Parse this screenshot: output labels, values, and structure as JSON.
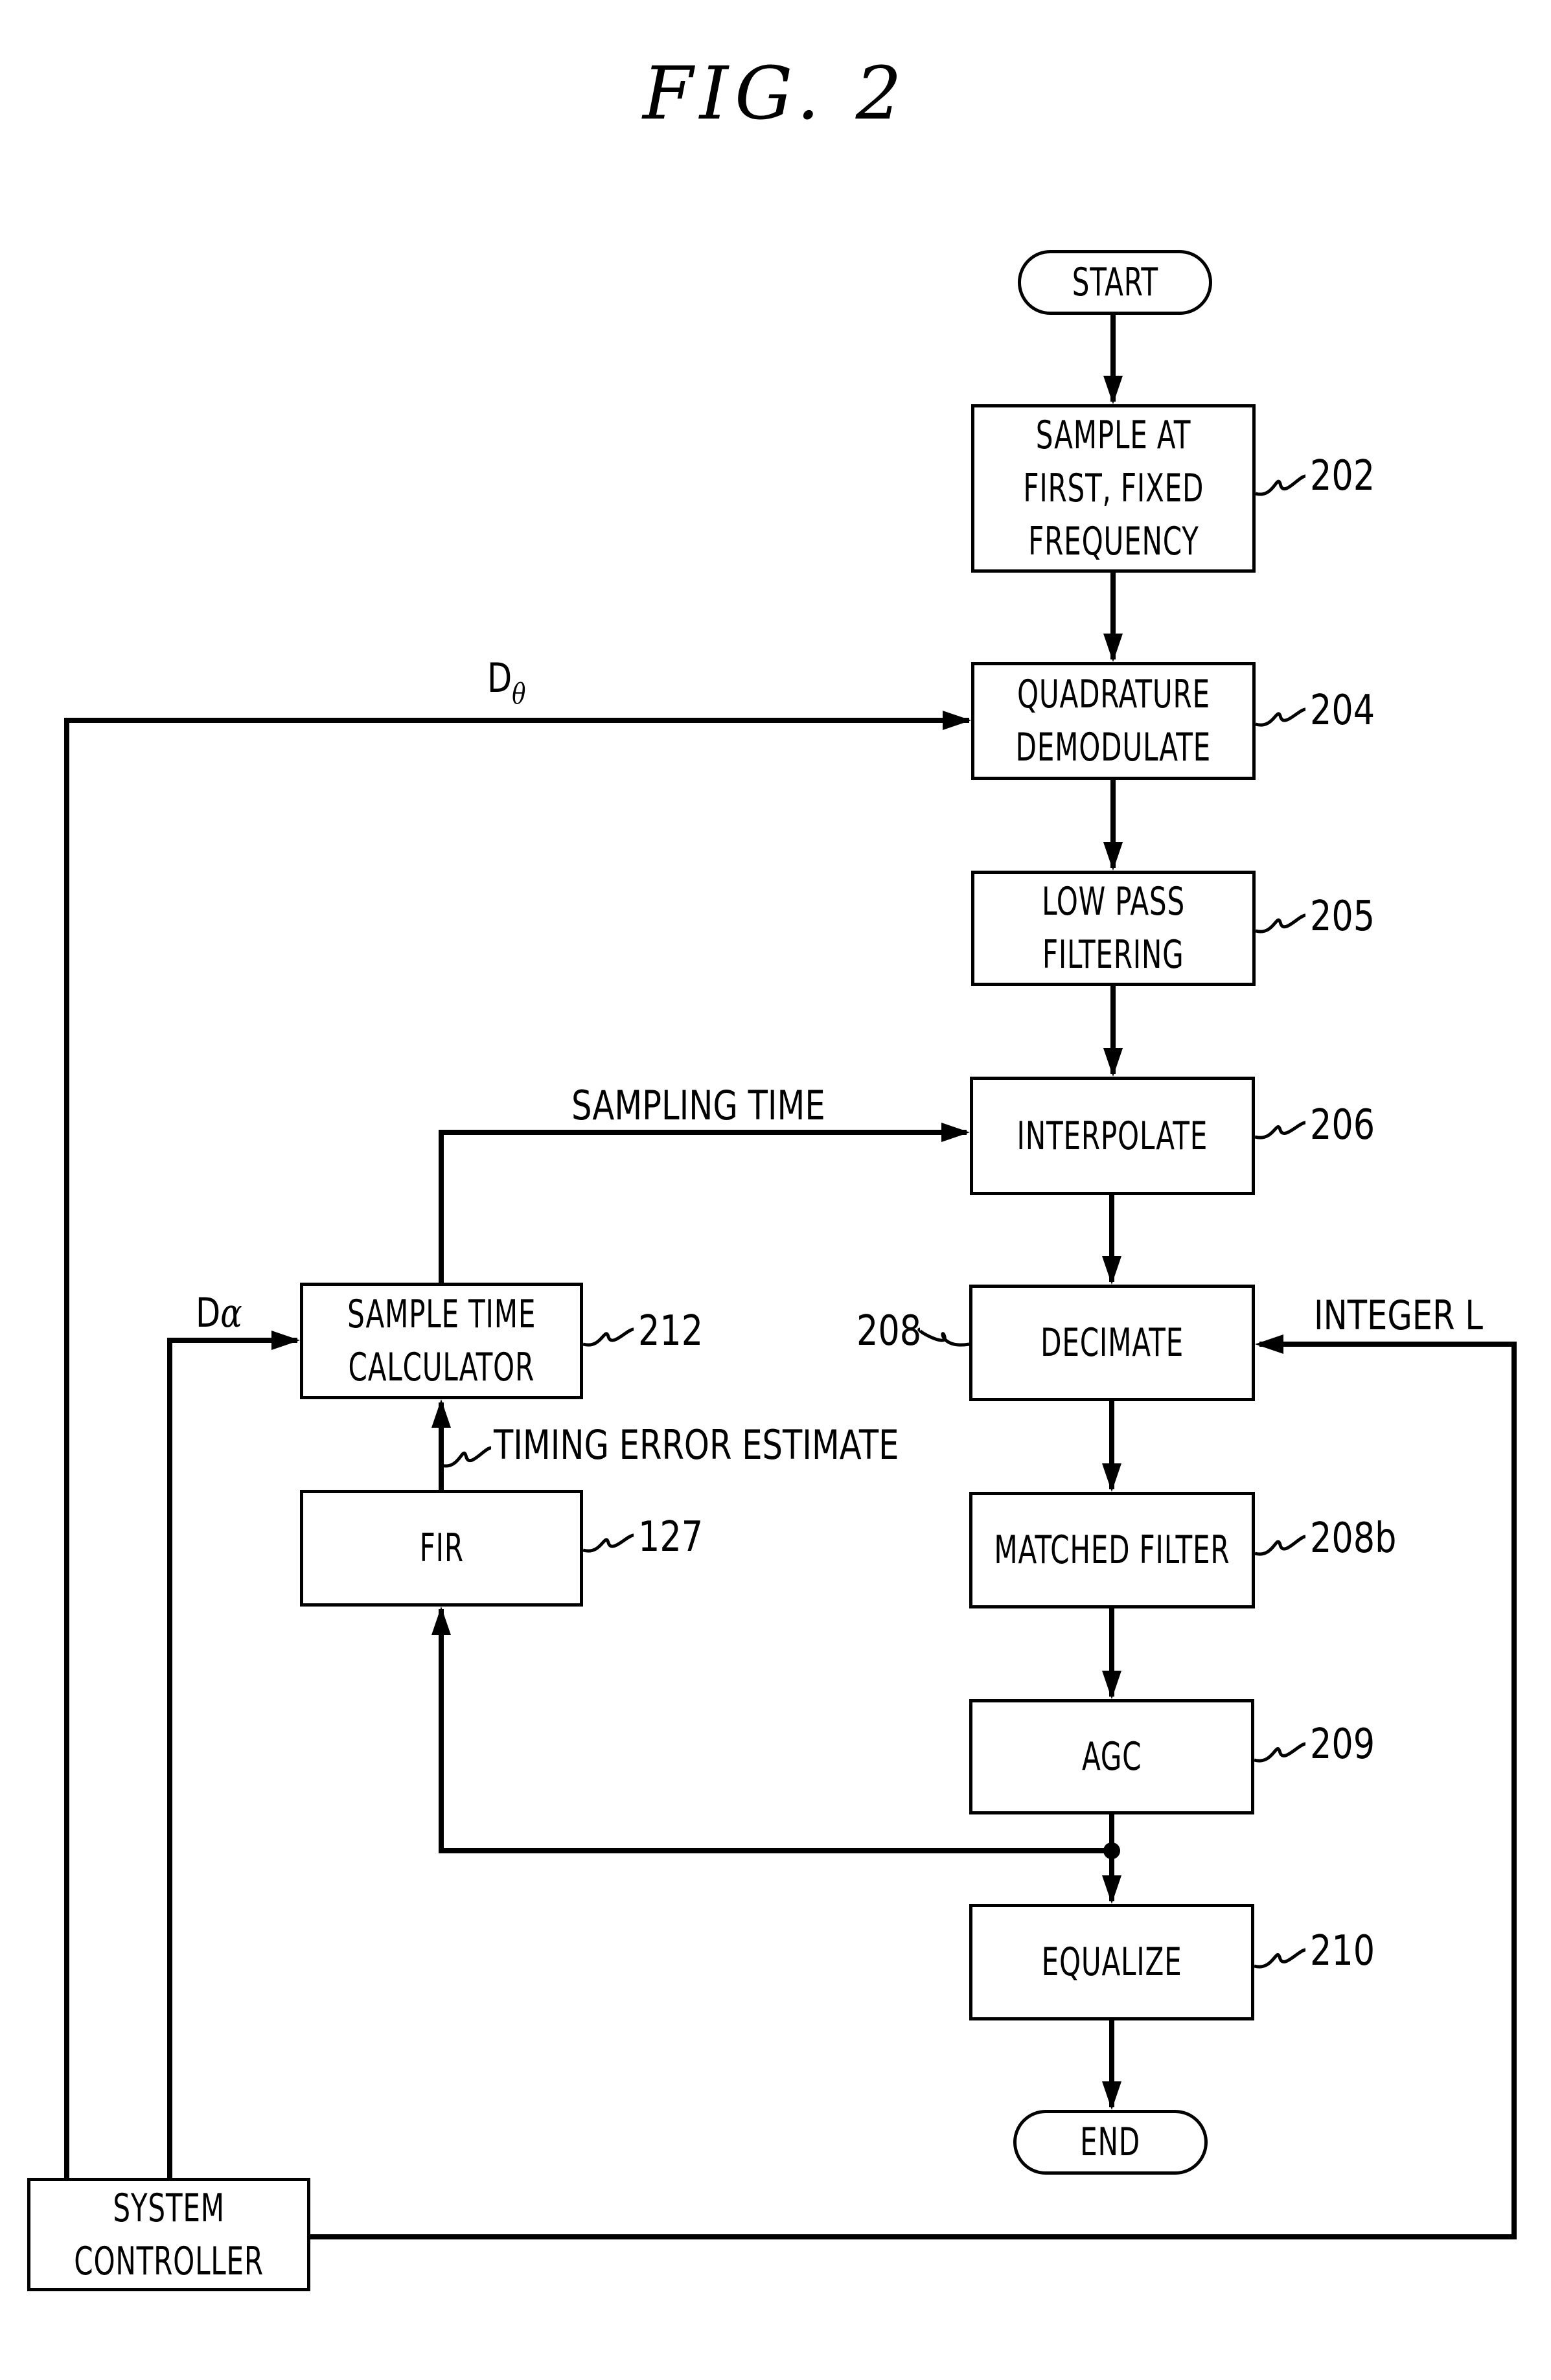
{
  "figure": {
    "title": "FIG. 2"
  },
  "nodes": {
    "start": {
      "lines": [
        "START"
      ]
    },
    "n202": {
      "lines": [
        "SAMPLE AT",
        "FIRST, FIXED",
        "FREQUENCY"
      ],
      "ref": "202"
    },
    "n204": {
      "lines": [
        "QUADRATURE",
        "DEMODULATE"
      ],
      "ref": "204"
    },
    "n205": {
      "lines": [
        "LOW PASS",
        "FILTERING"
      ],
      "ref": "205"
    },
    "n206": {
      "lines": [
        "INTERPOLATE"
      ],
      "ref": "206"
    },
    "n208": {
      "lines": [
        "DECIMATE"
      ],
      "ref": "208"
    },
    "n208b": {
      "lines": [
        "MATCHED FILTER"
      ],
      "ref": "208b"
    },
    "n209": {
      "lines": [
        "AGC"
      ],
      "ref": "209"
    },
    "n210": {
      "lines": [
        "EQUALIZE"
      ],
      "ref": "210"
    },
    "end": {
      "lines": [
        "END"
      ]
    },
    "n212": {
      "lines": [
        "SAMPLE TIME",
        "CALCULATOR"
      ],
      "ref": "212"
    },
    "n127": {
      "lines": [
        "FIR"
      ],
      "ref": "127"
    },
    "controller": {
      "lines": [
        "SYSTEM",
        "CONTROLLER"
      ]
    }
  },
  "signals": {
    "d_theta": {
      "main": "D",
      "sub": "θ"
    },
    "d_alpha": {
      "main": "D",
      "greek": "α"
    },
    "sampling_time": "SAMPLING TIME",
    "integer_l": "INTEGER L",
    "timing_error": "TIMING ERROR ESTIMATE"
  }
}
